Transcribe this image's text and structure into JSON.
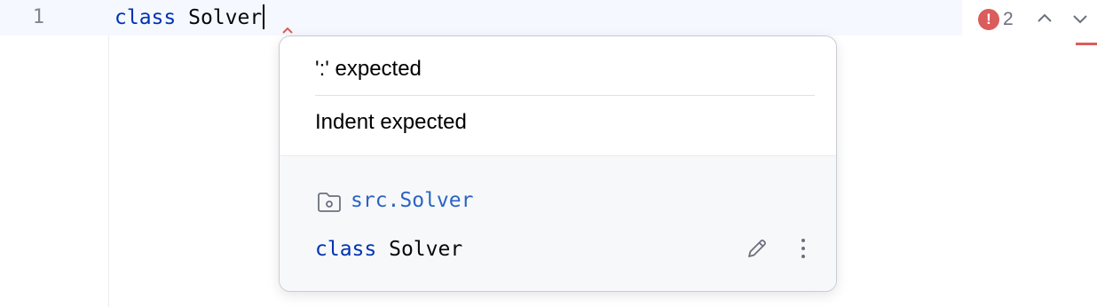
{
  "editor": {
    "line_number": "1",
    "code": {
      "keyword": "class",
      "name": "Solver"
    }
  },
  "inspection_widget": {
    "error_icon": "error-icon",
    "error_count": "2",
    "prev_icon": "chevron-up-icon",
    "next_icon": "chevron-down-icon"
  },
  "popup": {
    "problems": [
      {
        "message": "':' expected"
      },
      {
        "message": "Indent expected"
      }
    ],
    "documentation": {
      "module_icon": "folder-icon",
      "module": "src.Solver",
      "signature": {
        "keyword": "class",
        "name": "Solver"
      },
      "edit_icon": "pencil-icon",
      "more_icon": "more-vertical-icon"
    }
  },
  "colors": {
    "keyword": "#0033b3",
    "error": "#db5c5c",
    "link": "#2a64c2",
    "current_line": "#f5f8fe",
    "doc_background": "#f7f8fa"
  }
}
